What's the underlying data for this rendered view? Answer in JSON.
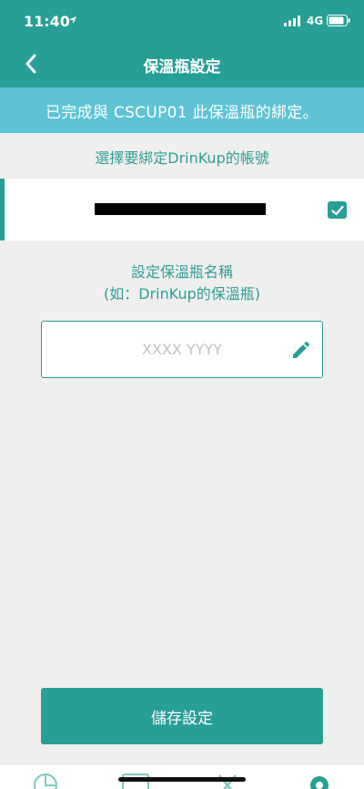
{
  "status_bar": {
    "time": "11:40",
    "network": "4G"
  },
  "nav": {
    "title": "保溫瓶設定"
  },
  "banner": {
    "text": "已完成與 CSCUP01 此保溫瓶的綁定。"
  },
  "account_section": {
    "label": "選擇要綁定DrinKup的帳號"
  },
  "account": {
    "value": "redacted account"
  },
  "name_section": {
    "label_line1": "設定保溫瓶名稱",
    "label_line2": "(如：DrinKup的保溫瓶)"
  },
  "name_input": {
    "placeholder": "XXXX YYYY",
    "value": ""
  },
  "save_button": {
    "label": "儲存設定"
  },
  "colors": {
    "primary": "#279f95",
    "banner": "#5ec3d4",
    "background": "#efefef"
  }
}
